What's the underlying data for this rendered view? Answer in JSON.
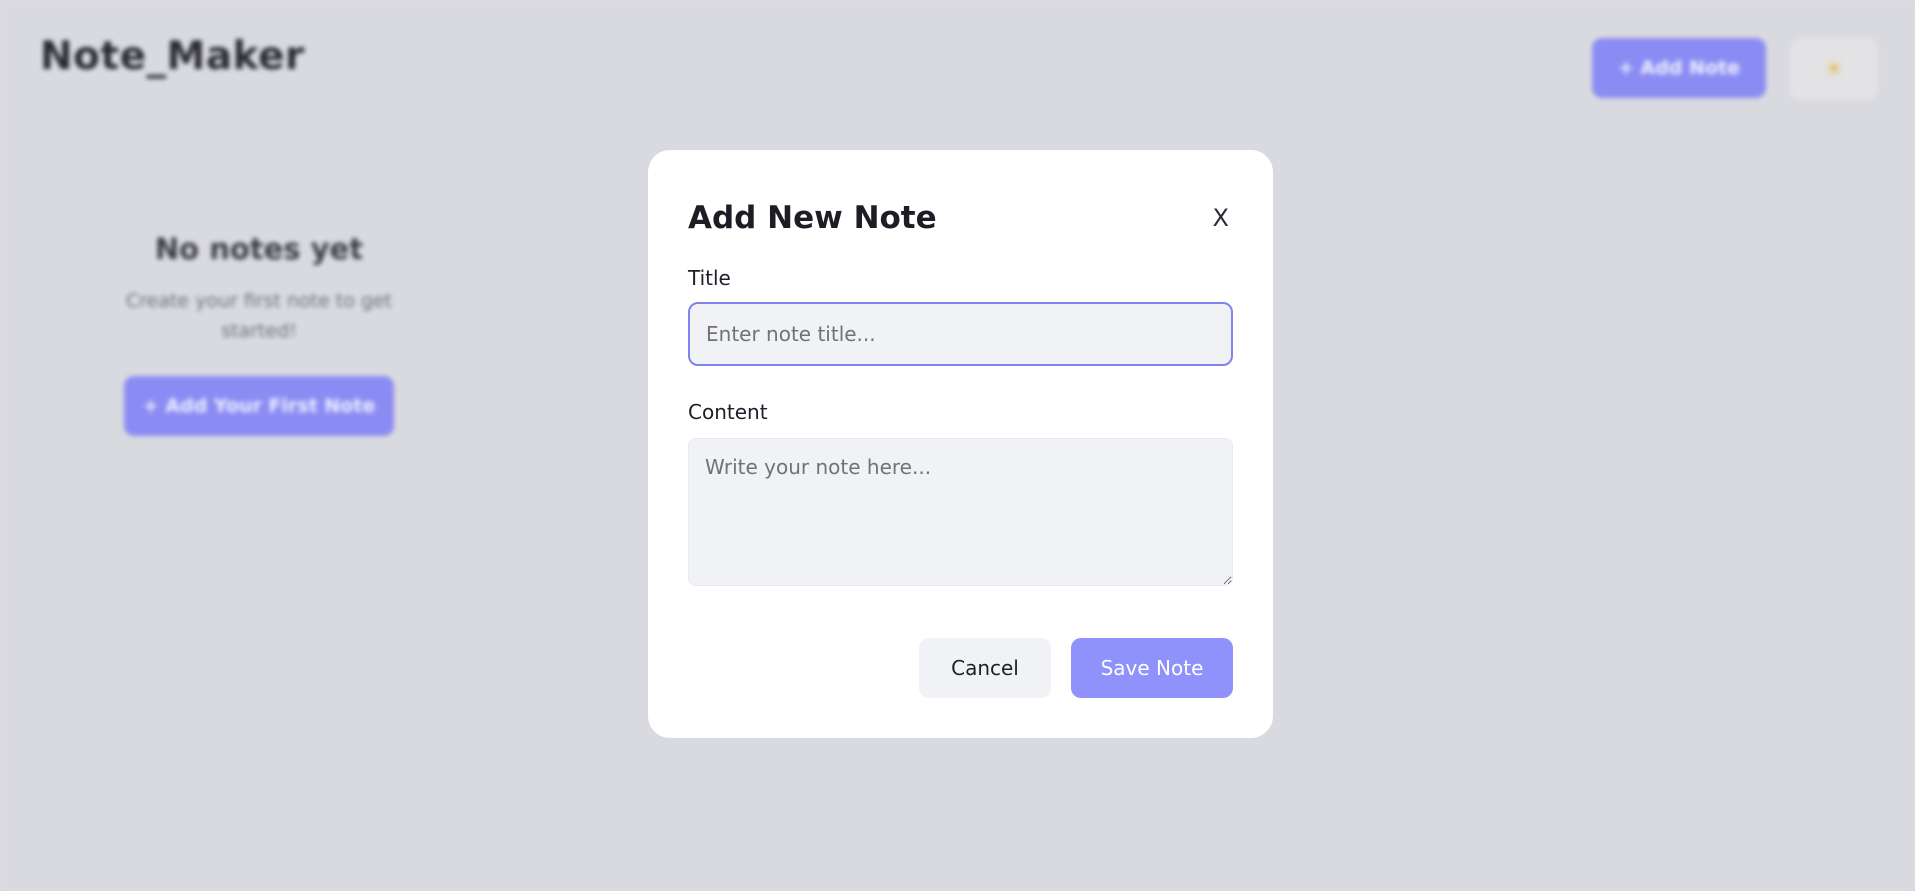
{
  "app": {
    "brand": "Note_Maker",
    "header_add_label": "+ Add Note",
    "theme_toggle_icon": "sun-icon"
  },
  "empty_state": {
    "title": "No notes yet",
    "subtitle": "Create your first note to get started!",
    "cta_label": "+ Add Your First Note"
  },
  "modal": {
    "title": "Add New Note",
    "close_label": "X",
    "title_field": {
      "label": "Title",
      "placeholder": "Enter note title...",
      "value": ""
    },
    "content_field": {
      "label": "Content",
      "placeholder": "Write your note here...",
      "value": ""
    },
    "cancel_label": "Cancel",
    "save_label": "Save Note"
  },
  "colors": {
    "accent": "#8e92fa",
    "backdrop": "#d9dadf",
    "focus_border": "#7f84ec"
  }
}
